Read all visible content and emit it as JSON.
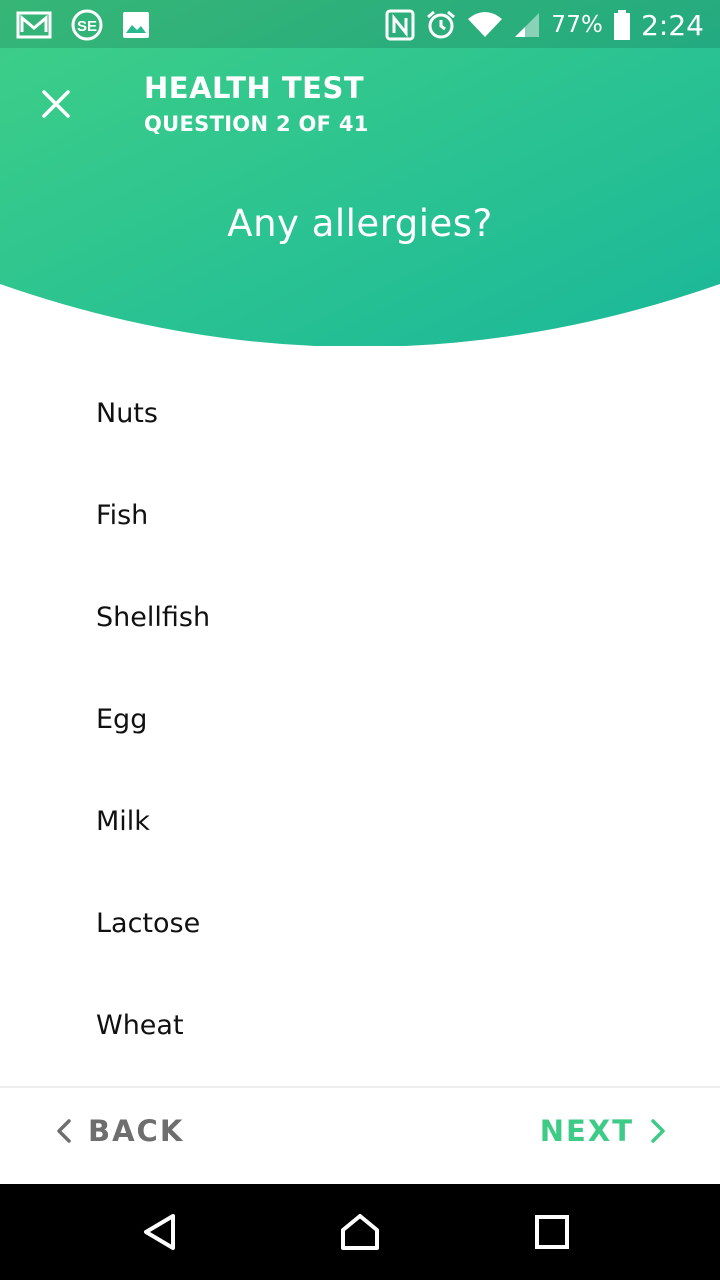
{
  "status_bar": {
    "left_icons": [
      "gmail-icon",
      "se-app-icon",
      "image-icon"
    ],
    "right_icons": [
      "nfc-icon",
      "alarm-icon",
      "wifi-icon",
      "signal-icon",
      "battery-icon"
    ],
    "battery": "77%",
    "time": "2:24"
  },
  "header": {
    "gradient": [
      "#3ecf87",
      "#1ab89a"
    ],
    "title": "HEALTH TEST",
    "subtitle": "QUESTION 2 OF 41",
    "question": "Any allergies?"
  },
  "options": [
    {
      "label": "Nuts"
    },
    {
      "label": "Fish"
    },
    {
      "label": "Shellfish"
    },
    {
      "label": "Egg"
    },
    {
      "label": "Milk"
    },
    {
      "label": "Lactose"
    },
    {
      "label": "Wheat"
    }
  ],
  "footer": {
    "back_label": "BACK",
    "next_label": "NEXT",
    "accent": "#3ecb87",
    "muted": "#6e6e6e"
  },
  "system_nav": [
    "back-triangle-icon",
    "home-icon",
    "recents-icon"
  ]
}
